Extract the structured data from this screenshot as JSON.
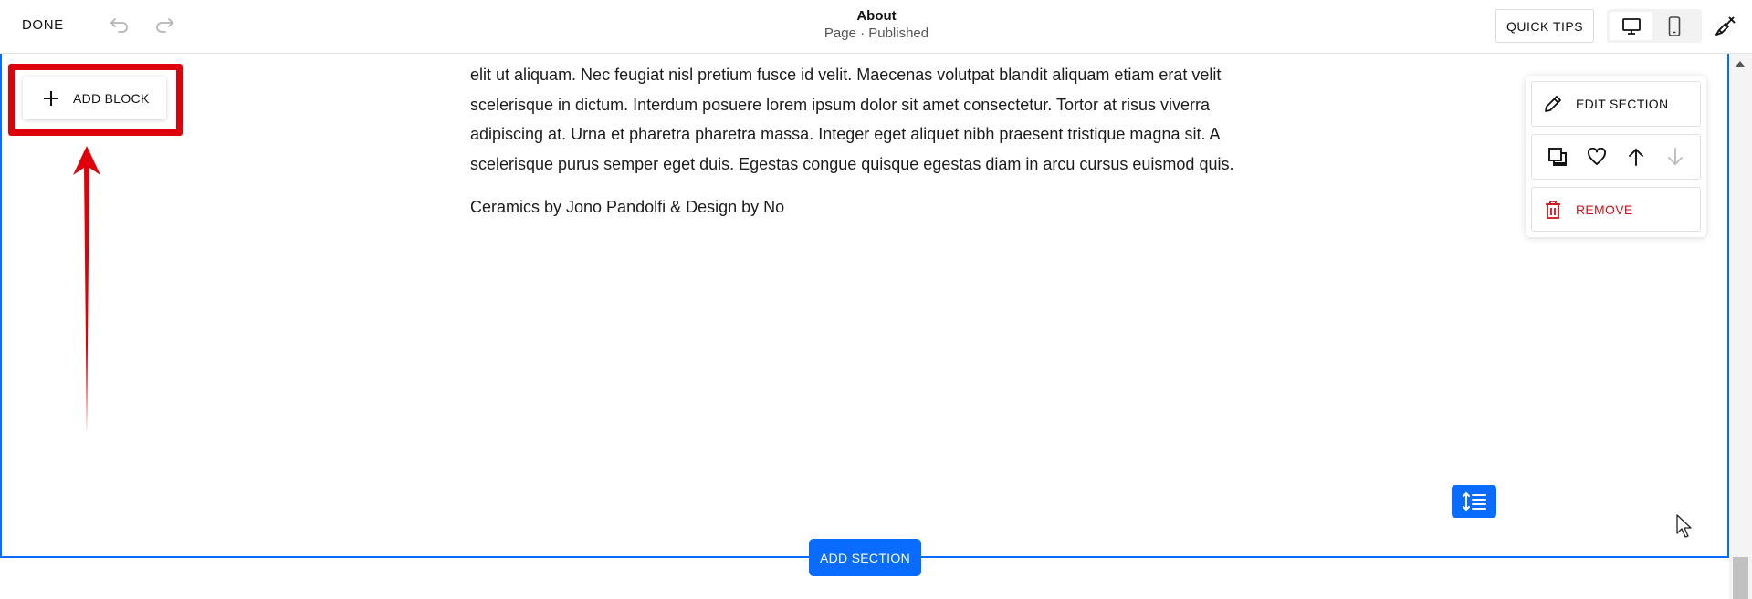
{
  "toolbar": {
    "done_label": "DONE",
    "page_title": "About",
    "page_status": "Page · Published",
    "quick_tips_label": "QUICK TIPS",
    "devices": [
      "desktop-icon",
      "mobile-icon"
    ],
    "active_device": "desktop"
  },
  "section": {
    "body_lines": [
      "elit ut aliquam. Nec feugiat nisl pretium fusce id velit. Maecenas volutpat blandit aliquam etiam erat velit",
      "scelerisque in dictum. Interdum posuere lorem ipsum dolor sit amet consectetur. Tortor at risus viverra",
      "adipiscing at. Urna et pharetra pharetra massa. Integer eget aliquet nibh praesent tristique magna sit. A",
      "scelerisque purus semper eget duis. Egestas congue quisque egestas diam in arcu cursus euismod quis."
    ],
    "credit": "Ceramics by Jono Pandolfi & Design by No",
    "add_block_label": "ADD BLOCK",
    "add_section_label": "ADD SECTION"
  },
  "section_menu": {
    "edit_label": "EDIT SECTION",
    "remove_label": "REMOVE",
    "tools": [
      "duplicate-icon",
      "heart-icon",
      "arrow-up-icon",
      "arrow-down-icon"
    ]
  },
  "colors": {
    "accent": "#0a6cff",
    "annotation": "#e0000a",
    "danger": "#d0121b"
  }
}
